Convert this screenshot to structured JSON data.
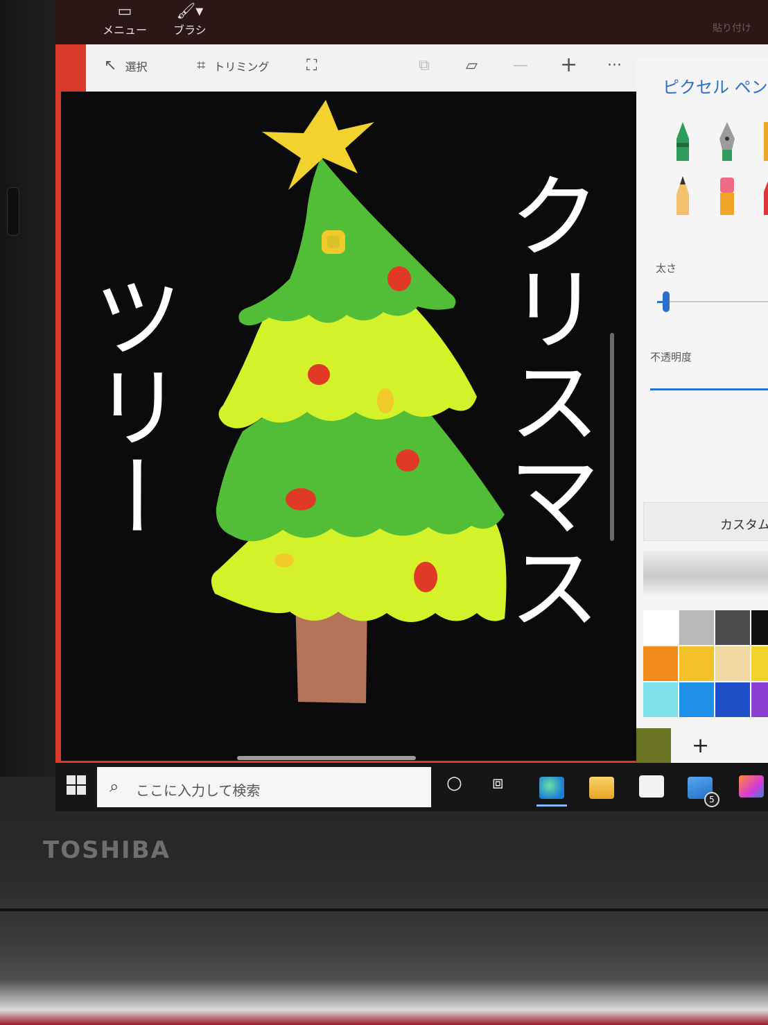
{
  "device": {
    "brand": "TOSHIBA"
  },
  "titlebar": {
    "menu_label": "メニュー",
    "menu_icon": "folder-icon",
    "brush_label": "ブラシ",
    "brush_icon": "brush-icon",
    "paste_label": "貼り付け"
  },
  "toolbar": {
    "select_label": "選択",
    "trim_label": "トリミング",
    "more_label": "···",
    "plus_label": "+",
    "minus_label": "—"
  },
  "canvas": {
    "background": "#0b0b0b",
    "text_left": "ツリー",
    "text_right": "クリスマス",
    "colors": {
      "star": "#f2d22e",
      "dark_green": "#52be37",
      "light_green": "#d3f22a",
      "trunk": "#b5735a",
      "ornament_red": "#e03a26",
      "ornament_yellow": "#f1c92a"
    }
  },
  "panel": {
    "title": "ピクセル ペン",
    "thickness_label": "太さ",
    "thickness_value": 0.1,
    "opacity_label": "不透明度",
    "opacity_value": 1.0,
    "custom_label": "カスタム",
    "palette": [
      [
        "#ffffff",
        "#b8b8b8",
        "#4d4d4d",
        "#111111"
      ],
      [
        "#f28a1c",
        "#f5c128",
        "#efd9a0",
        "#f2d32a"
      ],
      [
        "#7ee1ea",
        "#1e90e8",
        "#1f4fc9",
        "#8b3fd0"
      ]
    ],
    "current_color": "#6b7422",
    "add_label": "+"
  },
  "taskbar": {
    "search_placeholder": "ここに入力して検索",
    "mail_badge": "5",
    "accent": "#8ab8ff"
  }
}
